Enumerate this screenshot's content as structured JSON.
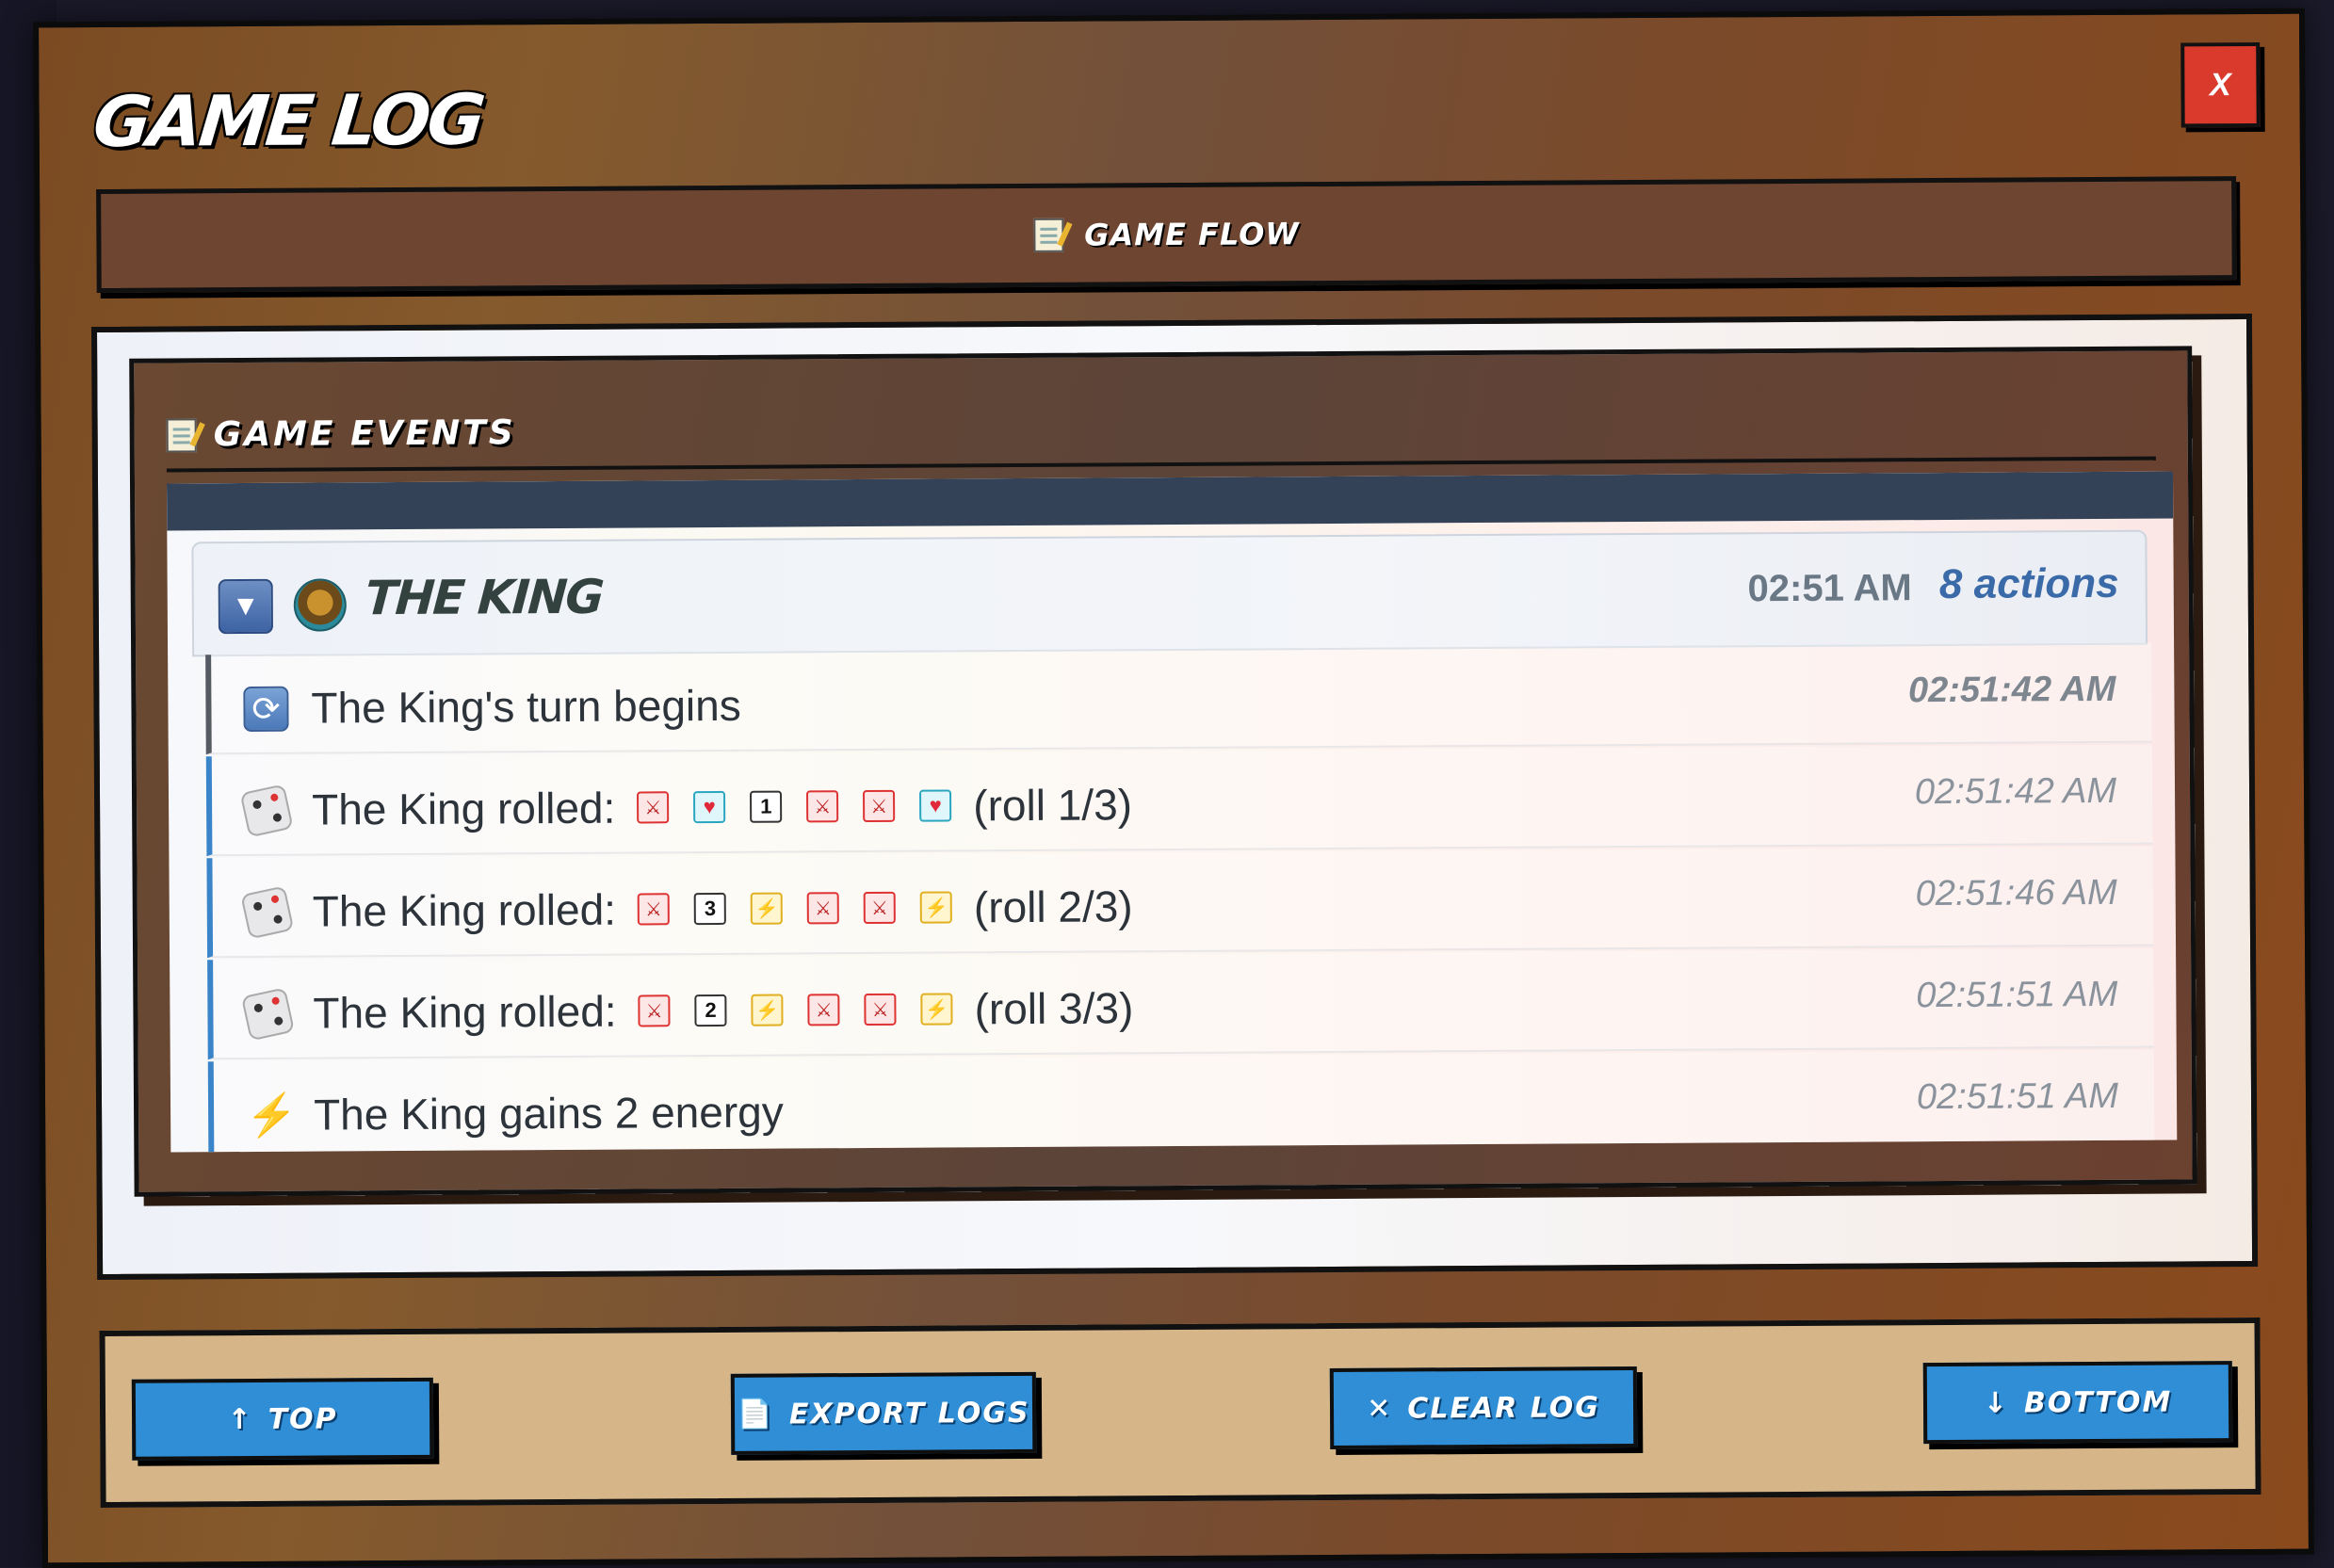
{
  "modal": {
    "title": "GAME LOG",
    "close_label": "X"
  },
  "flow": {
    "label": "GAME FLOW",
    "icon": "memo-icon"
  },
  "events": {
    "label": "GAME EVENTS",
    "icon": "memo-icon",
    "group": {
      "name": "THE KING",
      "time": "02:51 AM",
      "count": "8 actions",
      "collapse_icon": "triangle-down",
      "avatar_icon": "king-avatar"
    },
    "entries": [
      {
        "type": "turn",
        "icon": "refresh-icon",
        "text": "The King's turn begins",
        "time": "02:51:42 AM"
      },
      {
        "type": "roll",
        "icon": "dice-icon",
        "text": "The King rolled:",
        "dice": [
          "claw",
          "heart",
          "1",
          "claw",
          "claw",
          "heart"
        ],
        "suffix": "(roll 1/3)",
        "time": "02:51:42 AM"
      },
      {
        "type": "roll",
        "icon": "dice-icon",
        "text": "The King rolled:",
        "dice": [
          "claw",
          "3",
          "energy",
          "claw",
          "claw",
          "energy"
        ],
        "suffix": "(roll 2/3)",
        "time": "02:51:46 AM"
      },
      {
        "type": "roll",
        "icon": "dice-icon",
        "text": "The King rolled:",
        "dice": [
          "claw",
          "2",
          "energy",
          "claw",
          "claw",
          "energy"
        ],
        "suffix": "(roll 3/3)",
        "time": "02:51:51 AM"
      },
      {
        "type": "energy",
        "icon": "bolt-icon",
        "text": "The King gains 2 energy",
        "time": "02:51:51 AM"
      }
    ]
  },
  "footer": {
    "top_label": "TOP",
    "top_icon": "↑",
    "export_label": "EXPORT LOGS",
    "export_icon": "📄",
    "clear_label": "CLEAR LOG",
    "clear_icon": "✕",
    "bottom_label": "BOTTOM",
    "bottom_icon": "↓"
  },
  "colors": {
    "accent_blue": "#2f8ed6",
    "close_red": "#d93a2c",
    "frame_brown": "#7b4a22",
    "footer_tan": "#d6b689"
  }
}
